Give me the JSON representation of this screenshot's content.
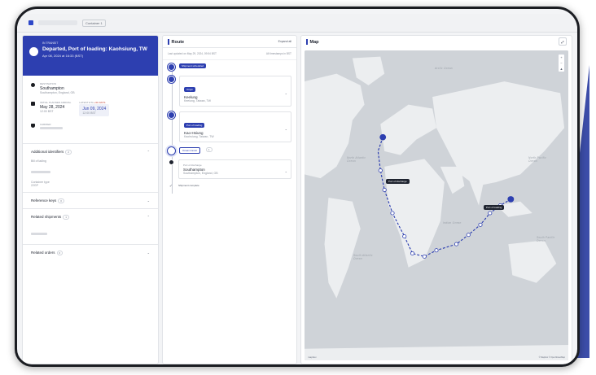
{
  "topbar": {
    "tag": "Container 1"
  },
  "status": {
    "label": "IN TRANSIT",
    "title": "Departed, Port of loading: Kaohsiung, TW",
    "date": "Apr 08, 2024 at 16:33 (BST)"
  },
  "destination": {
    "label": "DESTINATION",
    "name": "Southampton",
    "sub": "Southampton, England, GB"
  },
  "arrival": {
    "planned_label": "INITIAL PLANNED ARRIVAL",
    "planned_date": "May 28, 2024",
    "planned_time": "12:00 BST",
    "latest_label": "LATEST ETA",
    "latest_delay": "+31 days",
    "latest_date": "Jun 09, 2024",
    "latest_time": "12:00 BST"
  },
  "carrier": {
    "label": "CARRIER"
  },
  "sections": {
    "additional": {
      "label": "Additional identifiers",
      "count": "2"
    },
    "bol_label": "Bill of lading",
    "container_type_label": "Container type",
    "container_type_value": "22GP",
    "reference": {
      "label": "Reference keys",
      "count": "0"
    },
    "related_shipments": {
      "label": "Related shipments",
      "count": "1"
    },
    "related_orders": {
      "label": "Related orders",
      "count": "0"
    }
  },
  "route": {
    "title": "Route",
    "expand": "Expand all",
    "updated": "Last updated on May 29, 2024, 09:54 BST",
    "timezone": "All timestamps in BST",
    "events": [
      {
        "pill": "Shipment scheduled"
      },
      {
        "pill": "Origin",
        "name": "Keelung",
        "sub": "Keelung, Taiwan, TW"
      },
      {
        "pill": "Port of loading",
        "name": "Kao-Hsiung",
        "sub": "Kaohsiung, Taiwan, TW"
      },
      {
        "pill": "Ocean transit",
        "count": "1"
      },
      {
        "tag": "Port of discharge",
        "name": "Southampton",
        "sub": "Southampton, England, GB"
      },
      {
        "pill": "Shipment complete"
      }
    ]
  },
  "map": {
    "title": "Map",
    "pol_label": "Port of loading",
    "pod_label": "Port of discharge",
    "oceans": {
      "arctic": "Arctic Ocean",
      "north_atlantic": "North Atlantic Ocean",
      "north_pacific": "North Pacific Ocean",
      "south_pacific": "South Pacific Ocean",
      "indian": "Indian Ocean",
      "south_atlantic": "South Atlantic Ocean"
    },
    "attribution": "© Mapbox © OpenStreetMap",
    "logo": "mapbox"
  },
  "colors": {
    "accent": "#2d3fb0",
    "map_land": "#eceef0",
    "map_water": "#cfd3d8"
  }
}
